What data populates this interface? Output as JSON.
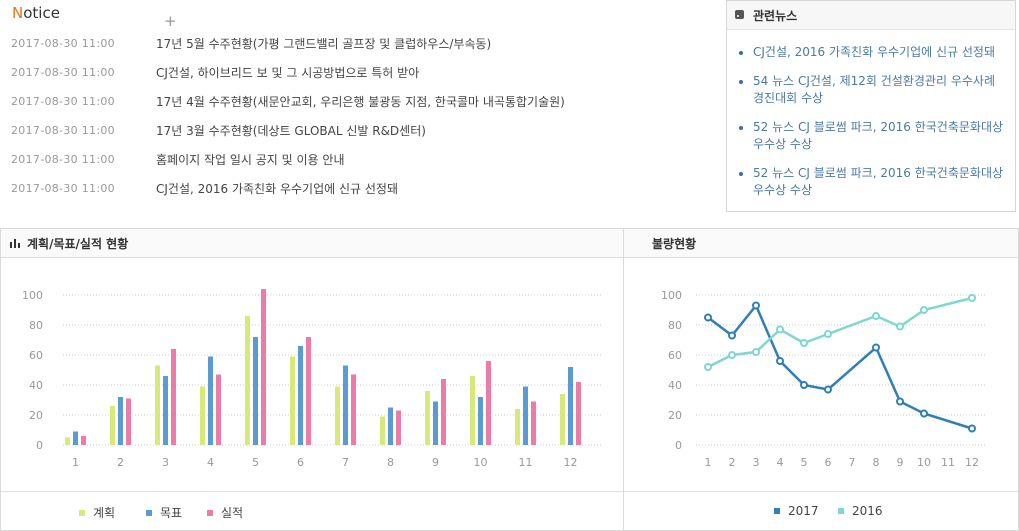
{
  "notice": {
    "title_first": "N",
    "title_rest": "otice",
    "more_icon": "plus-icon",
    "more_glyph": "+",
    "items": [
      {
        "date": "2017-08-30  11:00",
        "title": "17년 5월 수주현황(가평 그랜드밸리 골프장 및 클럽하우스/부속동)"
      },
      {
        "date": "2017-08-30  11:00",
        "title": "CJ건설, 하이브리드 보 및 그 시공방법으로 특허 받아"
      },
      {
        "date": "2017-08-30  11:00",
        "title": "17년 4월 수주현황(새문안교회, 우리은행 불광동 지점, 한국콜마 내곡통합기술원)"
      },
      {
        "date": "2017-08-30  11:00",
        "title": "17년 3월 수주현황(데상트 GLOBAL 신발 R&D센터)"
      },
      {
        "date": "2017-08-30  11:00",
        "title": "홈페이지 작업 일시 공지 및 이용 안내"
      },
      {
        "date": "2017-08-30  11:00",
        "title": "CJ건설, 2016 가족친화 우수기업에 신규 선정돼"
      }
    ]
  },
  "news": {
    "title": "관련뉴스",
    "icon": "rss-icon",
    "items": [
      "CJ건설, 2016 가족친화 우수기업에 신규 선정돼",
      "54 뉴스 CJ건설, 제12회 건설환경관리 우수사례 경진대회 수상",
      "52 뉴스 CJ 블로썸 파크, 2016 한국건축문화대상 우수상 수상",
      "52 뉴스 CJ 블로썸 파크, 2016 한국건축문화대상 우수상 수상"
    ]
  },
  "panels": {
    "left_title": "계획/목표/실적 현황",
    "left_icon": "bar-chart-icon",
    "right_title": "불량현황"
  },
  "colors": {
    "plan": "#d9e87a",
    "target": "#5b9bd5",
    "actual": "#ee7aa8",
    "y2017": "#2f7fb5",
    "y2016": "#7ed8cf"
  },
  "chart_data": [
    {
      "type": "bar",
      "categories": [
        "1",
        "2",
        "3",
        "4",
        "5",
        "6",
        "7",
        "8",
        "9",
        "10",
        "11",
        "12"
      ],
      "ylim": [
        0,
        100
      ],
      "yticks": [
        0,
        20,
        40,
        60,
        80,
        100
      ],
      "grid": true,
      "legend_position": "bottom-left",
      "series": [
        {
          "name": "계획",
          "values": [
            5,
            26,
            53,
            39,
            86,
            59,
            39,
            19,
            36,
            46,
            24,
            34
          ]
        },
        {
          "name": "목표",
          "values": [
            9,
            32,
            46,
            59,
            72,
            66,
            53,
            25,
            29,
            32,
            39,
            52
          ]
        },
        {
          "name": "실적",
          "values": [
            6,
            31,
            64,
            47,
            104,
            72,
            47,
            23,
            44,
            56,
            29,
            42
          ]
        }
      ]
    },
    {
      "type": "line",
      "categories": [
        "1",
        "2",
        "3",
        "4",
        "5",
        "6",
        "7",
        "8",
        "9",
        "10",
        "11",
        "12"
      ],
      "ylim": [
        0,
        100
      ],
      "yticks": [
        0,
        20,
        40,
        60,
        80,
        100
      ],
      "grid": true,
      "legend_position": "bottom-center",
      "series": [
        {
          "name": "2017",
          "values": [
            85,
            73,
            93,
            56,
            40,
            37,
            65,
            29,
            21,
            11
          ]
        },
        {
          "name": "2016",
          "values": [
            52,
            60,
            62,
            77,
            68,
            74,
            86,
            79,
            90,
            98
          ]
        }
      ],
      "series_x_index": [
        [
          0,
          1,
          2,
          3,
          4,
          5,
          7,
          8,
          9,
          11
        ],
        [
          0,
          1,
          2,
          3,
          4,
          5,
          7,
          8,
          9,
          11
        ]
      ]
    }
  ]
}
